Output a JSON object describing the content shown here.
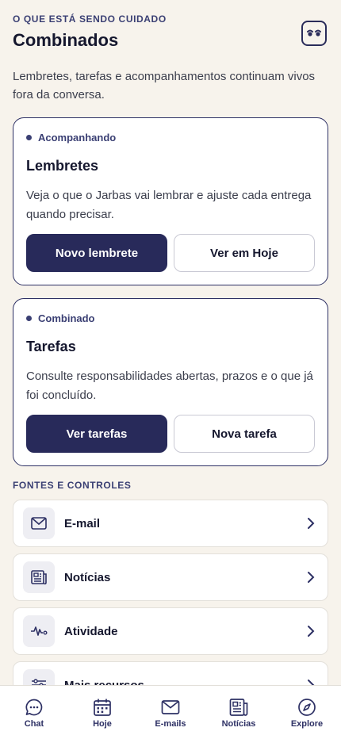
{
  "header": {
    "eyebrow": "O QUE ESTÁ SENDO CUIDADO",
    "title": "Combinados",
    "intro": "Lembretes, tarefas e acompanhamentos continuam vivos fora da conversa."
  },
  "cards": [
    {
      "status": "Acompanhando",
      "title": "Lembretes",
      "description": "Veja o que o Jarbas vai lembrar e ajuste cada entrega quando precisar.",
      "primary": "Novo lembrete",
      "secondary": "Ver em Hoje"
    },
    {
      "status": "Combinado",
      "title": "Tarefas",
      "description": "Consulte responsabilidades abertas, prazos e o que já foi concluído.",
      "primary": "Ver tarefas",
      "secondary": "Nova tarefa"
    }
  ],
  "sources": {
    "label": "FONTES E CONTROLES",
    "items": [
      {
        "label": "E-mail",
        "icon": "mail-icon"
      },
      {
        "label": "Notícias",
        "icon": "newspaper-icon"
      },
      {
        "label": "Atividade",
        "icon": "activity-icon"
      },
      {
        "label": "Mais recursos",
        "icon": "sliders-icon"
      }
    ]
  },
  "tabbar": {
    "items": [
      {
        "label": "Chat",
        "icon": "chat-icon"
      },
      {
        "label": "Hoje",
        "icon": "calendar-icon"
      },
      {
        "label": "E-mails",
        "icon": "mail-icon"
      },
      {
        "label": "Notícias",
        "icon": "newspaper-icon"
      },
      {
        "label": "Explore",
        "icon": "compass-icon"
      }
    ]
  },
  "colors": {
    "background": "#f7f3ec",
    "accent": "#282a5a",
    "text": "#15172e"
  }
}
